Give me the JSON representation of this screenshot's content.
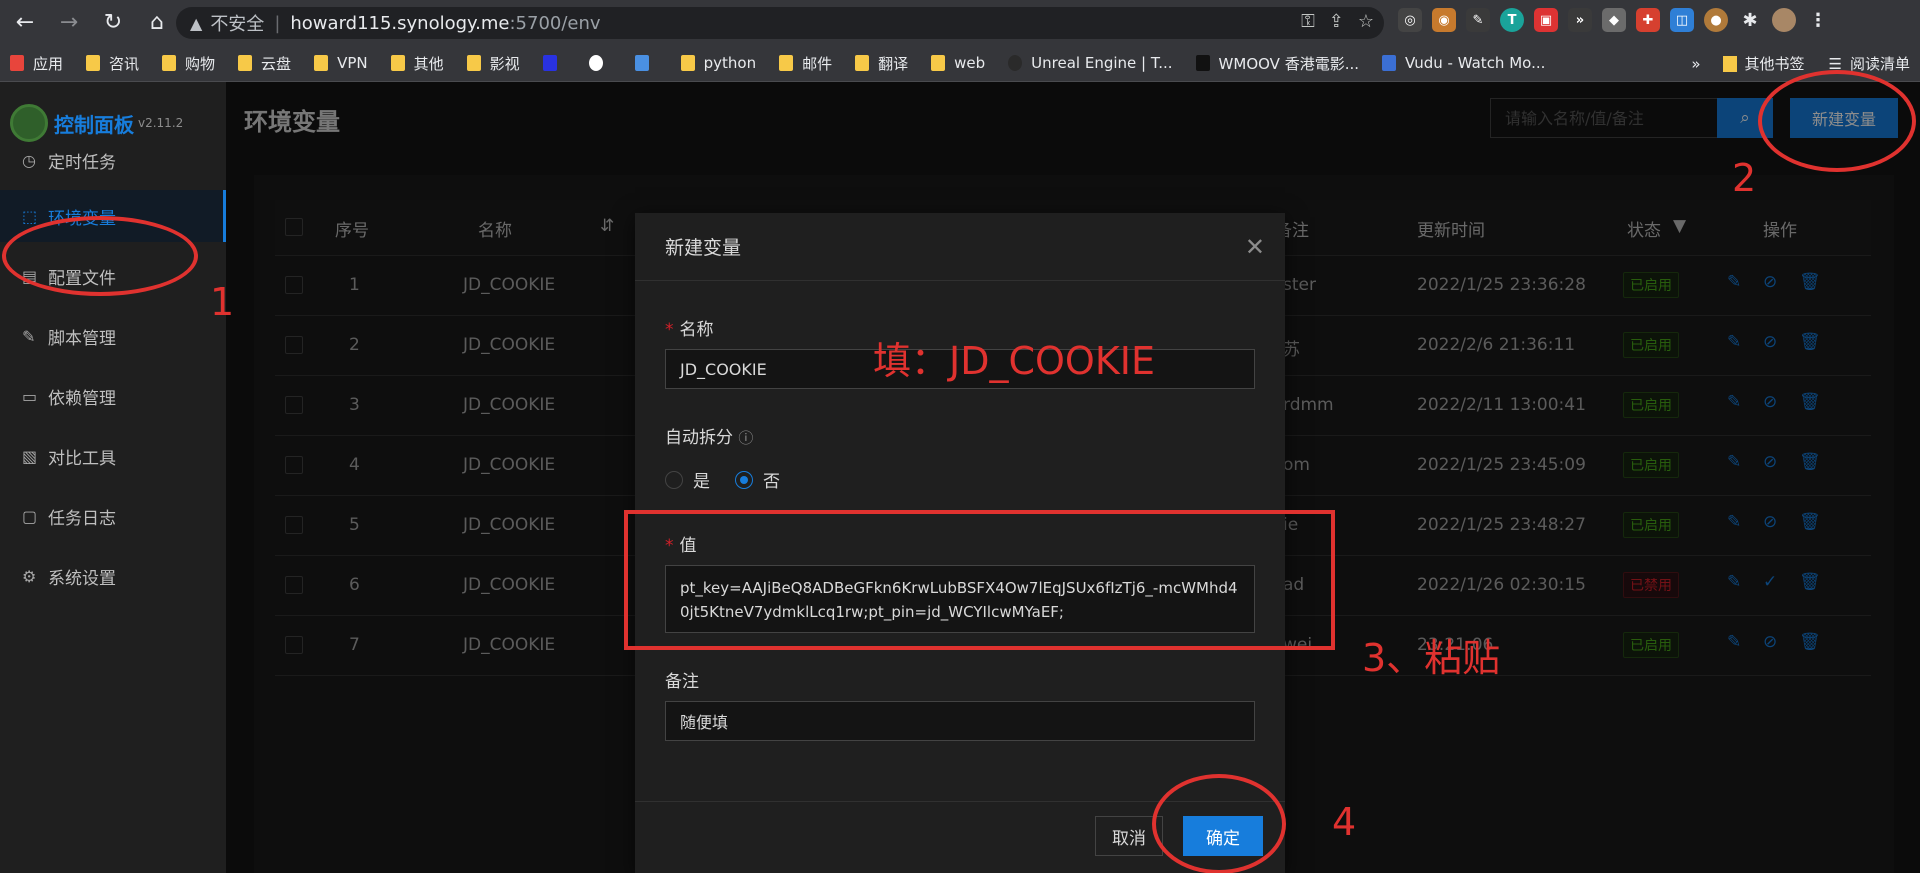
{
  "browser": {
    "insecure_label": "不安全",
    "url_host": "howard115.synology.me",
    "url_path": ":5700/env",
    "bookmarks": [
      "应用",
      "咨讯",
      "购物",
      "云盘",
      "VPN",
      "其他",
      "影视",
      "python",
      "邮件",
      "翻译",
      "web",
      "Unreal Engine | T...",
      "WMOOV 香港電影...",
      "Vudu - Watch Mo..."
    ],
    "bookmarks_more": "»",
    "bookmarks_right": [
      "其他书签",
      "阅读清单"
    ]
  },
  "sidebar": {
    "logo_text": "控制面板",
    "version": "v2.11.2",
    "items": [
      {
        "label": "定时任务",
        "icon": "clock-icon"
      },
      {
        "label": "环境变量",
        "icon": "box-icon"
      },
      {
        "label": "配置文件",
        "icon": "chart-icon"
      },
      {
        "label": "脚本管理",
        "icon": "edit-icon"
      },
      {
        "label": "依赖管理",
        "icon": "file-icon"
      },
      {
        "label": "对比工具",
        "icon": "diff-icon"
      },
      {
        "label": "任务日志",
        "icon": "folder-icon"
      },
      {
        "label": "系统设置",
        "icon": "gear-icon"
      }
    ]
  },
  "header": {
    "title": "环境变量",
    "search_placeholder": "请输入名称/值/备注",
    "new_button": "新建变量"
  },
  "table": {
    "columns": [
      "序号",
      "名称",
      "备注",
      "更新时间",
      "状态",
      "操作"
    ],
    "rows": [
      {
        "index": "1",
        "name": "JD_COOKIE",
        "remark": "ster",
        "time": "2022/1/25 23:36:28",
        "status": "已启用",
        "enabled": true
      },
      {
        "index": "2",
        "name": "JD_COOKIE",
        "remark": "苏",
        "time": "2022/2/6 21:36:11",
        "status": "已启用",
        "enabled": true
      },
      {
        "index": "3",
        "name": "JD_COOKIE",
        "remark": "rdmm",
        "time": "2022/2/11 13:00:41",
        "status": "已启用",
        "enabled": true
      },
      {
        "index": "4",
        "name": "JD_COOKIE",
        "remark": "om",
        "time": "2022/1/25 23:45:09",
        "status": "已启用",
        "enabled": true
      },
      {
        "index": "5",
        "name": "JD_COOKIE",
        "remark": "ie",
        "time": "2022/1/25 23:48:27",
        "status": "已启用",
        "enabled": true
      },
      {
        "index": "6",
        "name": "JD_COOKIE",
        "remark": "ad",
        "time": "2022/1/26 02:30:15",
        "status": "已禁用",
        "enabled": false
      },
      {
        "index": "7",
        "name": "JD_COOKIE",
        "remark": "wei",
        "time": "23:21:06",
        "status": "已启用",
        "enabled": true
      }
    ]
  },
  "modal": {
    "title": "新建变量",
    "name_label": "名称",
    "name_value": "JD_COOKIE",
    "auto_split_label": "自动拆分",
    "radio_yes": "是",
    "radio_no": "否",
    "value_label": "值",
    "value_text": "pt_key=AAJiBeQ8ADBeGFkn6KrwLubBSFX4Ow7lEqJSUx6fIzTj6_-mcWMhd40jt5KtneV7ydmklLcq1rw;pt_pin=jd_WCYIlcwMYaEF;",
    "remark_label": "备注",
    "remark_value": "随便填",
    "cancel": "取消",
    "ok": "确定"
  },
  "annotations": {
    "fill_hint": "填：JD_COOKIE",
    "step1": "1",
    "step2": "2",
    "step3": "3、粘贴",
    "step4": "4",
    "color": "#e0322f"
  }
}
